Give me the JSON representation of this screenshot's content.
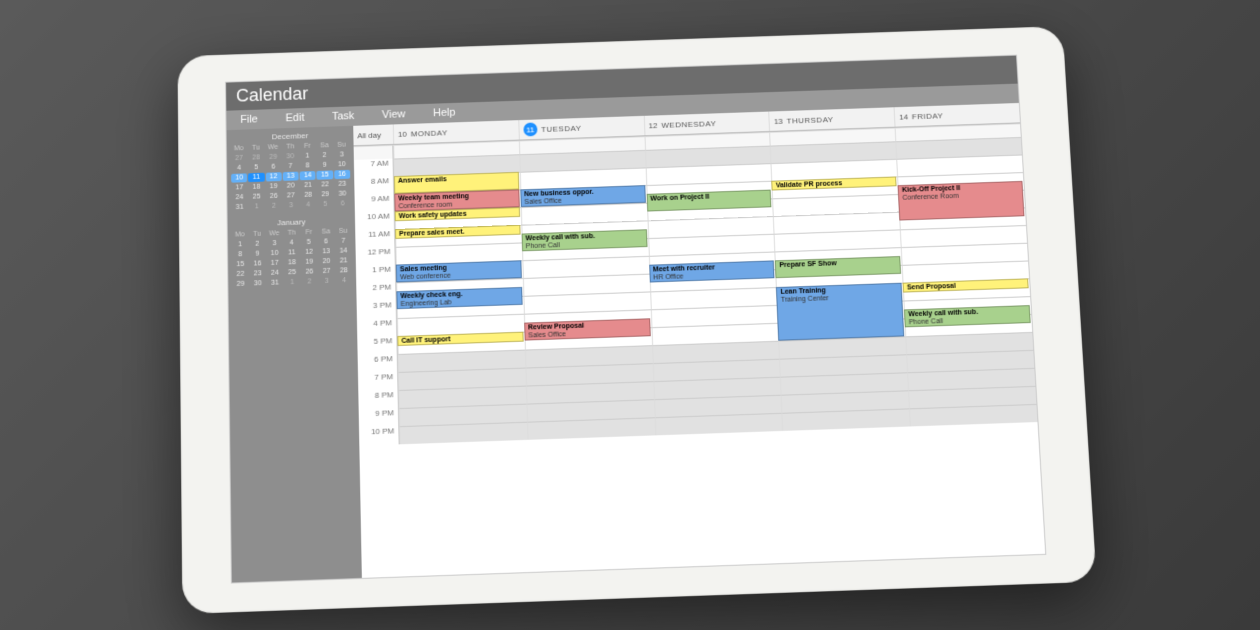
{
  "app_title": "Calendar",
  "menu": [
    "File",
    "Edit",
    "Task",
    "View",
    "Help"
  ],
  "sidebar": {
    "months": [
      {
        "title": "December",
        "dow": [
          "Mo",
          "Tu",
          "We",
          "Th",
          "Fr",
          "Sa",
          "Su"
        ],
        "cells": [
          {
            "n": "27",
            "cls": "dim"
          },
          {
            "n": "28",
            "cls": "dim"
          },
          {
            "n": "29",
            "cls": "dim"
          },
          {
            "n": "30",
            "cls": "dim"
          },
          {
            "n": "1"
          },
          {
            "n": "2"
          },
          {
            "n": "3"
          },
          {
            "n": "4"
          },
          {
            "n": "5"
          },
          {
            "n": "6"
          },
          {
            "n": "7"
          },
          {
            "n": "8"
          },
          {
            "n": "9"
          },
          {
            "n": "10"
          },
          {
            "n": "10",
            "cls": "hl"
          },
          {
            "n": "11",
            "cls": "sel"
          },
          {
            "n": "12",
            "cls": "hl"
          },
          {
            "n": "13",
            "cls": "hl"
          },
          {
            "n": "14",
            "cls": "hl"
          },
          {
            "n": "15",
            "cls": "hl"
          },
          {
            "n": "16",
            "cls": "hl"
          },
          {
            "n": "17"
          },
          {
            "n": "18"
          },
          {
            "n": "19"
          },
          {
            "n": "20"
          },
          {
            "n": "21"
          },
          {
            "n": "22"
          },
          {
            "n": "23"
          },
          {
            "n": "24"
          },
          {
            "n": "25"
          },
          {
            "n": "26"
          },
          {
            "n": "27"
          },
          {
            "n": "28"
          },
          {
            "n": "29"
          },
          {
            "n": "30"
          },
          {
            "n": "31"
          },
          {
            "n": "1",
            "cls": "dim"
          },
          {
            "n": "2",
            "cls": "dim"
          },
          {
            "n": "3",
            "cls": "dim"
          },
          {
            "n": "4",
            "cls": "dim"
          },
          {
            "n": "5",
            "cls": "dim"
          },
          {
            "n": "6",
            "cls": "dim"
          }
        ]
      },
      {
        "title": "January",
        "dow": [
          "Mo",
          "Tu",
          "We",
          "Th",
          "Fr",
          "Sa",
          "Su"
        ],
        "cells": [
          {
            "n": "1"
          },
          {
            "n": "2"
          },
          {
            "n": "3"
          },
          {
            "n": "4"
          },
          {
            "n": "5"
          },
          {
            "n": "6"
          },
          {
            "n": "7"
          },
          {
            "n": "8"
          },
          {
            "n": "9"
          },
          {
            "n": "10"
          },
          {
            "n": "11"
          },
          {
            "n": "12"
          },
          {
            "n": "13"
          },
          {
            "n": "14"
          },
          {
            "n": "15"
          },
          {
            "n": "16"
          },
          {
            "n": "17"
          },
          {
            "n": "18"
          },
          {
            "n": "19"
          },
          {
            "n": "20"
          },
          {
            "n": "21"
          },
          {
            "n": "22"
          },
          {
            "n": "23"
          },
          {
            "n": "24"
          },
          {
            "n": "25"
          },
          {
            "n": "26"
          },
          {
            "n": "27"
          },
          {
            "n": "28"
          },
          {
            "n": "29"
          },
          {
            "n": "30"
          },
          {
            "n": "31"
          },
          {
            "n": "1",
            "cls": "dim"
          },
          {
            "n": "2",
            "cls": "dim"
          },
          {
            "n": "3",
            "cls": "dim"
          },
          {
            "n": "4",
            "cls": "dim"
          }
        ]
      }
    ]
  },
  "week": {
    "allday_label": "All day",
    "days": [
      {
        "num": "10",
        "name": "MONDAY",
        "today": false
      },
      {
        "num": "11",
        "name": "TUESDAY",
        "today": true
      },
      {
        "num": "12",
        "name": "WEDNESDAY",
        "today": false
      },
      {
        "num": "13",
        "name": "THURSDAY",
        "today": false
      },
      {
        "num": "14",
        "name": "FRIDAY",
        "today": false
      }
    ],
    "hours": [
      "7 AM",
      "8 AM",
      "9 AM",
      "10 AM",
      "11 AM",
      "12 PM",
      "1 PM",
      "2 PM",
      "3 PM",
      "4 PM",
      "5 PM",
      "6 PM",
      "7 PM",
      "8 PM",
      "9 PM",
      "10 PM"
    ],
    "events": [
      {
        "title": "Answer emails",
        "subtitle": "",
        "day": 0,
        "startHour": 8,
        "durHours": 1,
        "color": "yellow"
      },
      {
        "title": "Weekly team meeting",
        "subtitle": "Conference room",
        "day": 0,
        "startHour": 9,
        "durHours": 1,
        "color": "red"
      },
      {
        "title": "Work safety updates",
        "subtitle": "",
        "day": 0,
        "startHour": 10,
        "durHours": 0.5,
        "color": "yellow"
      },
      {
        "title": "Prepare sales meet.",
        "subtitle": "",
        "day": 0,
        "startHour": 11,
        "durHours": 0.5,
        "color": "yellow"
      },
      {
        "title": "Sales meeting",
        "subtitle": "Web conference",
        "day": 0,
        "startHour": 13,
        "durHours": 1,
        "color": "blue"
      },
      {
        "title": "Weekly check eng.",
        "subtitle": "Engineering Lab",
        "day": 0,
        "startHour": 14.5,
        "durHours": 1,
        "color": "blue"
      },
      {
        "title": "Call IT support",
        "subtitle": "",
        "day": 0,
        "startHour": 17,
        "durHours": 0.5,
        "color": "yellow"
      },
      {
        "title": "New business oppor.",
        "subtitle": "Sales Office",
        "day": 1,
        "startHour": 9,
        "durHours": 1,
        "color": "blue"
      },
      {
        "title": "Weekly call with sub.",
        "subtitle": "Phone Call",
        "day": 1,
        "startHour": 11.5,
        "durHours": 1,
        "color": "green"
      },
      {
        "title": "Review Proposal",
        "subtitle": "Sales Office",
        "day": 1,
        "startHour": 16.5,
        "durHours": 1,
        "color": "red"
      },
      {
        "title": "Work on Project II",
        "subtitle": "",
        "day": 2,
        "startHour": 9.5,
        "durHours": 1,
        "color": "green"
      },
      {
        "title": "Meet with recruiter",
        "subtitle": "HR Office",
        "day": 2,
        "startHour": 13.5,
        "durHours": 1,
        "color": "blue"
      },
      {
        "title": "Validate PR process",
        "subtitle": "",
        "day": 3,
        "startHour": 9,
        "durHours": 0.5,
        "color": "yellow"
      },
      {
        "title": "Prepare SF Show",
        "subtitle": "",
        "day": 3,
        "startHour": 13.5,
        "durHours": 1,
        "color": "green"
      },
      {
        "title": "Lean Training",
        "subtitle": "Training Center",
        "day": 3,
        "startHour": 15,
        "durHours": 3,
        "color": "blue"
      },
      {
        "title": "Kick-Off Project II",
        "subtitle": "Conference Room",
        "day": 4,
        "startHour": 9.5,
        "durHours": 2,
        "color": "red"
      },
      {
        "title": "Send Proposal",
        "subtitle": "",
        "day": 4,
        "startHour": 15,
        "durHours": 0.5,
        "color": "yellow"
      },
      {
        "title": "Weekly call with sub.",
        "subtitle": "Phone Call",
        "day": 4,
        "startHour": 16.5,
        "durHours": 1,
        "color": "green"
      }
    ]
  }
}
